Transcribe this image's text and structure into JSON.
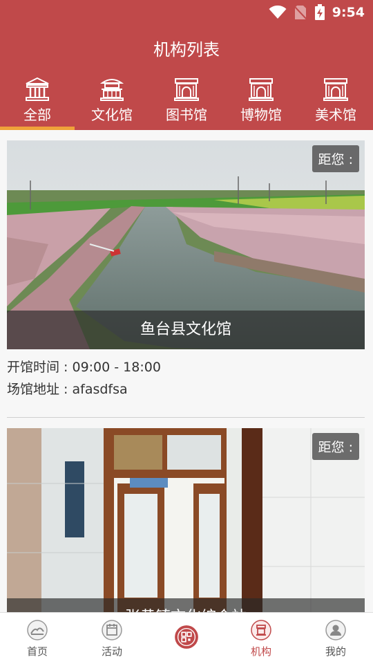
{
  "status": {
    "time": "9:54"
  },
  "header": {
    "title": "机构列表"
  },
  "tabs": [
    {
      "label": "全部",
      "active": true
    },
    {
      "label": "文化馆",
      "active": false
    },
    {
      "label": "图书馆",
      "active": false
    },
    {
      "label": "博物馆",
      "active": false
    },
    {
      "label": "美术馆",
      "active": false
    }
  ],
  "cards": [
    {
      "distance": "距您 :",
      "name": "鱼台县文化馆",
      "hours": "开馆时间 : 09:00 - 18:00",
      "address": "场馆地址 : afasdfsa"
    },
    {
      "distance": "距您 :",
      "name": "张黄镇文化综合站"
    }
  ],
  "nav": [
    {
      "label": "首页",
      "icon": "home-icon"
    },
    {
      "label": "活动",
      "icon": "calendar-icon"
    },
    {
      "label": "",
      "icon": "qr-code-icon"
    },
    {
      "label": "机构",
      "icon": "institution-icon",
      "active": true
    },
    {
      "label": "我的",
      "icon": "user-icon"
    }
  ],
  "colors": {
    "brand": "#c0494a",
    "accent": "#f0a23a"
  }
}
